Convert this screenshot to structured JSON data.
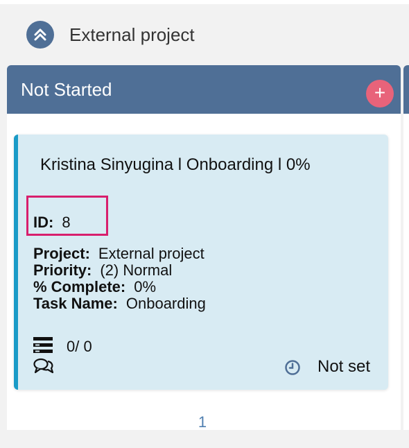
{
  "group": {
    "title": "External project"
  },
  "column": {
    "title": "Not Started",
    "add_label": "+"
  },
  "card": {
    "title": "Kristina Sinyugina  l  Onboarding  l  0%",
    "id_label": "ID:",
    "id_value": "8",
    "details": [
      {
        "label": "Project:",
        "value": "External project"
      },
      {
        "label": "Priority:",
        "value": "(2) Normal"
      },
      {
        "label": "% Complete:",
        "value": "0%"
      },
      {
        "label": "Task Name:",
        "value": "Onboarding"
      }
    ],
    "checklist": "0/ 0",
    "due": "Not set",
    "accent_color": "#1a9bc7",
    "background_color": "#d8ebf3"
  },
  "highlight_color": "#d81f6d",
  "pagination": {
    "current_page": "1"
  },
  "icons": {
    "collapse": "double-chevron-up-icon",
    "add": "plus-icon",
    "checklist": "checklist-icon",
    "comments": "comments-icon",
    "due": "clock-icon"
  }
}
